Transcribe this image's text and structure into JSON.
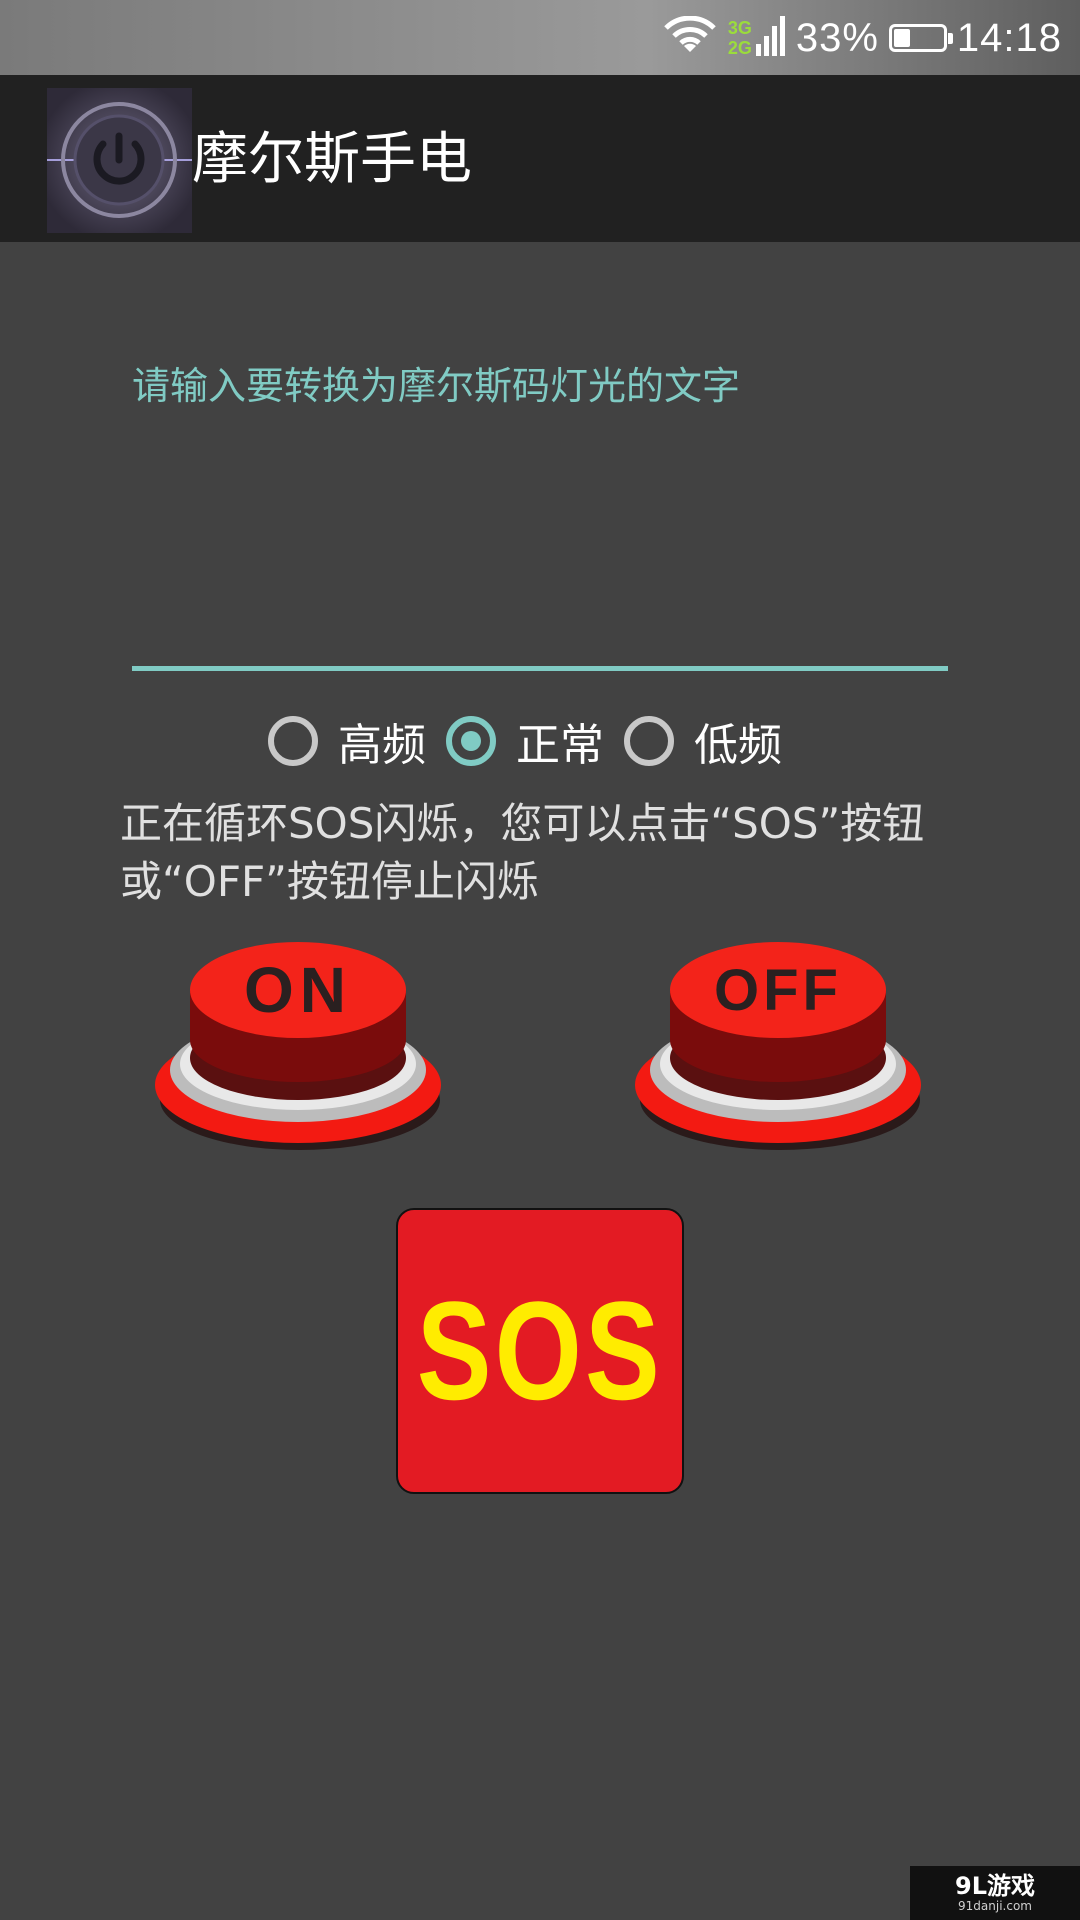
{
  "status_bar": {
    "network_top": "3G",
    "network_bottom": "2G",
    "battery": "33%",
    "battery_level": 0.33,
    "time": "14:18"
  },
  "action_bar": {
    "title": "摩尔斯手电",
    "icon": "power-icon"
  },
  "main": {
    "input_hint": "请输入要转换为摩尔斯码灯光的文字",
    "input_value": "",
    "frequency_options": [
      {
        "label": "高频",
        "checked": false
      },
      {
        "label": "正常",
        "checked": true
      },
      {
        "label": "低频",
        "checked": false
      }
    ],
    "status_message": "正在循环SOS闪烁，您可以点击“SOS”按钮或“OFF”按钮停止闪烁",
    "buttons": {
      "on_label": "ON",
      "off_label": "OFF",
      "sos_label": "SOS"
    }
  },
  "watermark": {
    "main": "9L游戏",
    "sub": "91danji.com"
  },
  "colors": {
    "accent": "#80cbc4",
    "background": "#424242",
    "action_bar": "#212121",
    "button_red": "#e31b23",
    "sos_text": "#ffec00"
  }
}
